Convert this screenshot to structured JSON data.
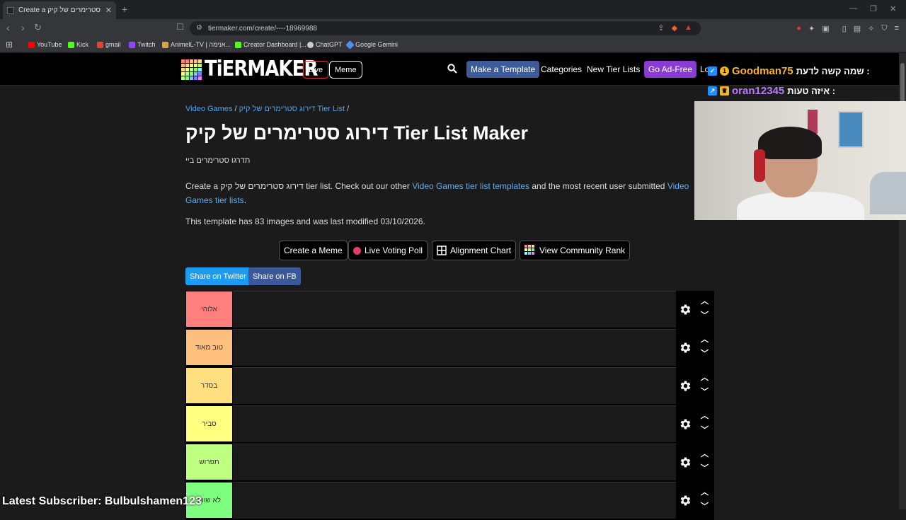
{
  "browser": {
    "tab_title": "Create a דירוג סטרימרים של קיק",
    "url": "tiermaker.com/create/----18969988",
    "bookmarks": [
      {
        "label": "YouTube",
        "color": "#ff0000"
      },
      {
        "label": "Kick",
        "color": "#53fc18"
      },
      {
        "label": "gmail",
        "color": "#ea4335"
      },
      {
        "label": "Twitch",
        "color": "#9146ff"
      },
      {
        "label": "AnimelL-TV | אנימה...",
        "color": "#e0a040"
      },
      {
        "label": "Creator Dashboard |...",
        "color": "#53fc18"
      },
      {
        "label": "ChatGPT",
        "color": "#cccccc"
      },
      {
        "label": "Google Gemini",
        "color": "#4e8df5"
      }
    ]
  },
  "site_header": {
    "logo_text": "TiERMAKER",
    "live_label": "Live",
    "meme_label": "Meme",
    "make_template_label": "Make a Template",
    "categories_label": "Categories",
    "new_tier_lists_label": "New Tier Lists",
    "go_ad_free_label": "Go Ad-Free",
    "login_label": "Lo"
  },
  "breadcrumb": {
    "category": "Video Games",
    "list": "דירוג סטרימרים של קיק Tier List"
  },
  "main": {
    "title": "דירוג סטרימרים של קיק Tier List Maker",
    "description": "תדרגו סטרימרים ביי",
    "intro_prefix": "Create a דירוג סטרימרים של קיק tier list. Check out our other ",
    "intro_link1": "Video Games tier list templates",
    "intro_middle": " and the most recent user submitted ",
    "intro_link2": "Video Games tier lists",
    "intro_suffix": ".",
    "template_info": "This template has 83 images and was last modified 03/10/2026."
  },
  "actions": {
    "create_meme": "Create a Meme",
    "live_voting_poll": "Live Voting Poll",
    "alignment_chart": "Alignment Chart",
    "view_community_rank": "View Community Rank",
    "share_twitter": "Share on Twitter",
    "share_fb": "Share on FB"
  },
  "tiers": [
    {
      "label": "אלוהי",
      "color": "#ff7f7f"
    },
    {
      "label": "טוב מאוד",
      "color": "#ffbf7f"
    },
    {
      "label": "בסדר",
      "color": "#ffdf7f"
    },
    {
      "label": "סביר",
      "color": "#ffff7f"
    },
    {
      "label": "תפרוש",
      "color": "#bfff7f"
    },
    {
      "label": "לא שווה",
      "color": "#7fff7f"
    }
  ],
  "overlay": {
    "line1_text": "שמה קשה לדעת :",
    "line1_name": "Goodman75",
    "line1_badge": "1",
    "line2_text": "איזה טעות :",
    "line2_name": "oran12345",
    "latest_subscriber": "Latest Subscriber: Bulbulshamen123"
  }
}
